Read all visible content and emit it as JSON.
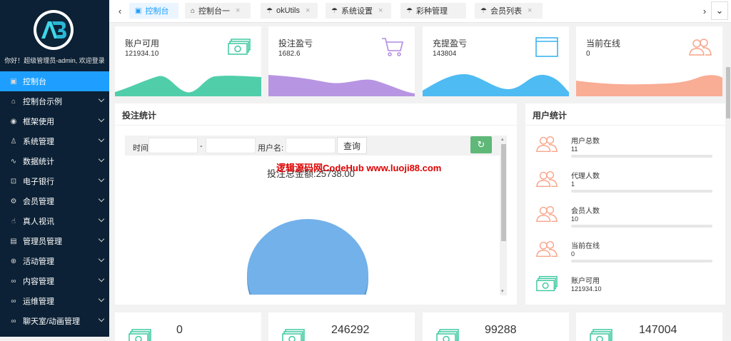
{
  "sidebar": {
    "logo_text": "AB",
    "welcome": "你好！超级管理员-admin, 欢迎登录",
    "items": [
      {
        "label": "控制台",
        "icon": "monitor-icon",
        "glyph": "▣",
        "active": true,
        "has_children": false
      },
      {
        "label": "控制台示例",
        "icon": "home-icon",
        "glyph": "⌂",
        "active": false,
        "has_children": true
      },
      {
        "label": "框架使用",
        "icon": "ok-icon",
        "glyph": "◉",
        "active": false,
        "has_children": true
      },
      {
        "label": "系统管理",
        "icon": "user-icon",
        "glyph": "♙",
        "active": false,
        "has_children": true
      },
      {
        "label": "数据统计",
        "icon": "pulse-icon",
        "glyph": "∿",
        "active": false,
        "has_children": true
      },
      {
        "label": "电子银行",
        "icon": "bank-icon",
        "glyph": "⊡",
        "active": false,
        "has_children": true
      },
      {
        "label": "会员管理",
        "icon": "gear-icon",
        "glyph": "⚙",
        "active": false,
        "has_children": true
      },
      {
        "label": "真人视讯",
        "icon": "hand-icon",
        "glyph": "☝",
        "active": false,
        "has_children": true
      },
      {
        "label": "管理员管理",
        "icon": "list-icon",
        "glyph": "▤",
        "active": false,
        "has_children": true
      },
      {
        "label": "活动管理",
        "icon": "plus-circle-icon",
        "glyph": "⊕",
        "active": false,
        "has_children": true
      },
      {
        "label": "内容管理",
        "icon": "infinity-icon",
        "glyph": "∞",
        "active": false,
        "has_children": true
      },
      {
        "label": "运维管理",
        "icon": "infinity-icon",
        "glyph": "∞",
        "active": false,
        "has_children": true
      },
      {
        "label": "聊天室/动画管理",
        "icon": "infinity-icon",
        "glyph": "∞",
        "active": false,
        "has_children": true
      }
    ]
  },
  "tabs": [
    {
      "label": "控制台",
      "icon": "monitor-icon",
      "glyph": "▣",
      "active": true,
      "closable": false
    },
    {
      "label": "控制台一",
      "icon": "home-icon",
      "glyph": "⌂",
      "active": false,
      "closable": true
    },
    {
      "label": "okUtils",
      "icon": "umbrella-icon",
      "glyph": "☂",
      "active": false,
      "closable": true
    },
    {
      "label": "系统设置",
      "icon": "umbrella-icon",
      "glyph": "☂",
      "active": false,
      "closable": true
    },
    {
      "label": "彩种管理",
      "icon": "umbrella-icon",
      "glyph": "☂",
      "active": false,
      "closable": false
    },
    {
      "label": "会员列表",
      "icon": "umbrella-icon",
      "glyph": "☂",
      "active": false,
      "closable": true
    }
  ],
  "tab_controls": {
    "prev": "‹",
    "next": "›",
    "close": "×",
    "more": "⌄"
  },
  "stats": [
    {
      "title": "账户可用",
      "value": "121934.10",
      "icon": "money-icon",
      "color": "#3dc9a1"
    },
    {
      "title": "投注盈亏",
      "value": "1682.6",
      "icon": "cart-icon",
      "color": "#b08ae0"
    },
    {
      "title": "充提盈亏",
      "value": "143804",
      "icon": "window-icon",
      "color": "#3bb4f2"
    },
    {
      "title": "当前在线",
      "value": "0",
      "icon": "users-icon",
      "color": "#f8a48a"
    }
  ],
  "bet_panel": {
    "title": "投注统计",
    "time_label": "时间:",
    "dash": "-",
    "username_label": "用户名:",
    "query_button": "查询",
    "refresh_icon": "↻",
    "chart_title": "投注总金额:25738.00",
    "watermark": "逻辑源码网CodeHub www.luoji88.com",
    "scroll_up": "▴",
    "scroll_down": "▾"
  },
  "chart_data": {
    "type": "pie",
    "title": "投注总金额:25738.00",
    "slices": [
      {
        "value": 25738.0
      }
    ],
    "colors": [
      "#73b1ea"
    ]
  },
  "user_stats": {
    "title": "用户统计",
    "rows": [
      {
        "label": "用户总数",
        "value": "11",
        "icon": "users-icon"
      },
      {
        "label": "代理人数",
        "value": "1",
        "icon": "users-icon"
      },
      {
        "label": "会员人数",
        "value": "10",
        "icon": "users-icon"
      },
      {
        "label": "当前在线",
        "value": "0",
        "icon": "users-icon"
      },
      {
        "label": "账户可用",
        "value": "121934.10",
        "icon": "money-icon"
      }
    ]
  },
  "bottom_stats": [
    {
      "value": "0",
      "icon": "money-icon"
    },
    {
      "value": "246292",
      "icon": "money-icon"
    },
    {
      "value": "99288",
      "icon": "money-icon"
    },
    {
      "value": "147004",
      "icon": "money-icon"
    }
  ]
}
